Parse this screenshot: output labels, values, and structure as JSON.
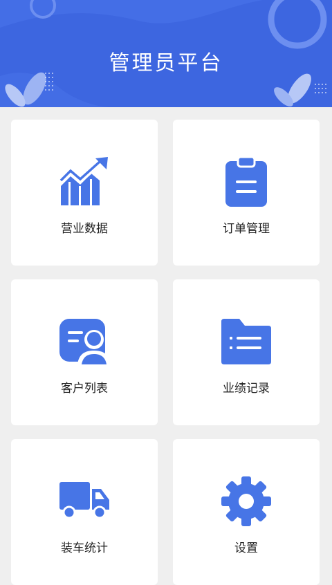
{
  "header": {
    "title": "管理员平台"
  },
  "colors": {
    "accent": "#3d66e0",
    "icon": "#4775e6",
    "background": "#efefef"
  },
  "menu": [
    {
      "label": "营业数据",
      "icon": "chart-trend-icon"
    },
    {
      "label": "订单管理",
      "icon": "clipboard-icon"
    },
    {
      "label": "客户列表",
      "icon": "contact-card-icon"
    },
    {
      "label": "业绩记录",
      "icon": "folder-list-icon"
    },
    {
      "label": "装车统计",
      "icon": "truck-icon"
    },
    {
      "label": "设置",
      "icon": "gear-icon"
    }
  ]
}
